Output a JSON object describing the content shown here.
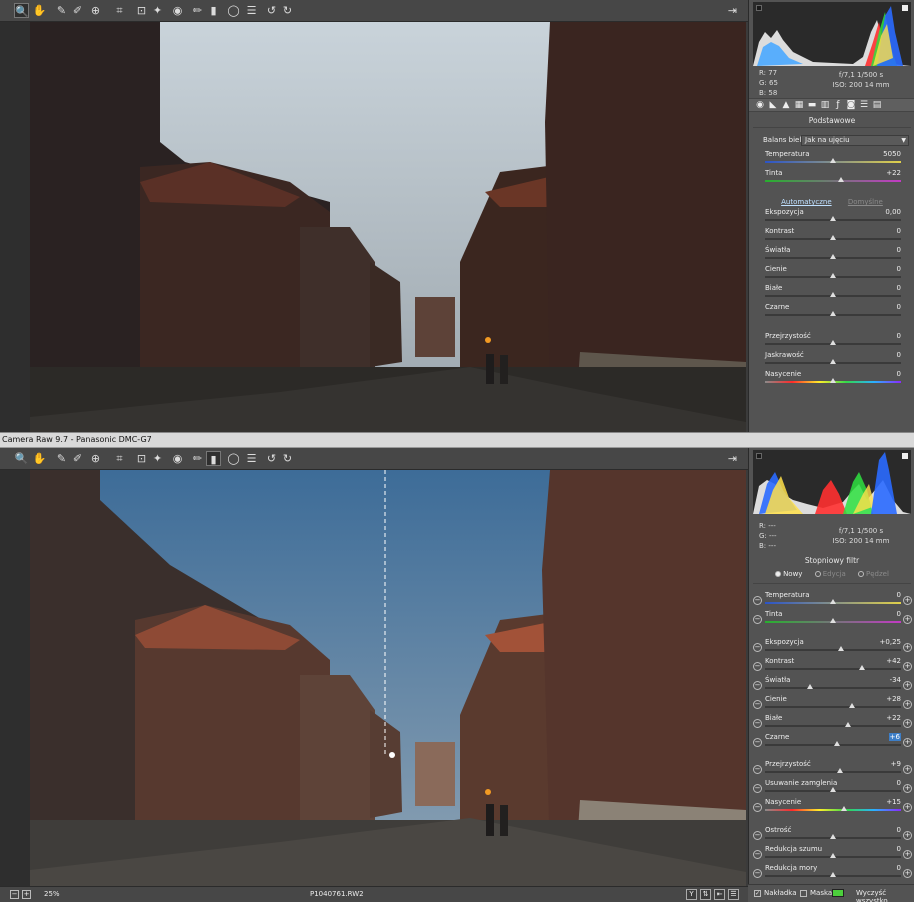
{
  "colors": {
    "accent": "#3d7ec7",
    "mask_color": "#4ccf3c"
  },
  "titlebar": {
    "title": "Camera Raw 9.7  -  Panasonic DMC-G7"
  },
  "toolbar": {
    "tools": [
      "zoom-icon",
      "hand-icon",
      "white-balance-icon",
      "color-sampler-icon",
      "targeted-adjustment-icon",
      "crop-icon",
      "straighten-icon",
      "spot-removal-icon",
      "red-eye-icon",
      "adjustment-brush-icon",
      "graduated-filter-icon",
      "radial-filter-icon",
      "preferences-icon",
      "rotate-left-icon",
      "rotate-right-icon"
    ],
    "export_icon": "open-fullscreen-icon"
  },
  "top": {
    "rgb": {
      "r": "R:   77",
      "g": "G:   65",
      "b": "B:   58"
    },
    "exif": {
      "line1": "f/7,1   1/500 s",
      "line2": "ISO: 200   14 mm"
    },
    "section": "Podstawowe",
    "wb_label": "Balans bieli:",
    "wb_value": "Jak na ujęciu",
    "sliders": [
      {
        "label": "Temperatura",
        "value": "5050",
        "pos": 0.5,
        "track": "temp"
      },
      {
        "label": "Tinta",
        "value": "+22",
        "pos": 0.56,
        "track": "tint"
      }
    ],
    "auto_link": "Automatyczne",
    "default_link": "Domyślne",
    "tone": [
      {
        "label": "Ekspozycja",
        "value": "0,00",
        "pos": 0.5
      },
      {
        "label": "Kontrast",
        "value": "0",
        "pos": 0.5
      },
      {
        "label": "Światła",
        "value": "0",
        "pos": 0.5
      },
      {
        "label": "Cienie",
        "value": "0",
        "pos": 0.5
      },
      {
        "label": "Białe",
        "value": "0",
        "pos": 0.5
      },
      {
        "label": "Czarne",
        "value": "0",
        "pos": 0.5
      }
    ],
    "presence": [
      {
        "label": "Przejrzystość",
        "value": "0",
        "pos": 0.5
      },
      {
        "label": "Jaskrawość",
        "value": "0",
        "pos": 0.5
      },
      {
        "label": "Nasycenie",
        "value": "0",
        "pos": 0.5,
        "track": "sat"
      }
    ]
  },
  "bottom": {
    "rgb": {
      "r": "R:   ---",
      "g": "G:   ---",
      "b": "B:   ---"
    },
    "exif": {
      "line1": "f/7,1   1/500 s",
      "line2": "ISO: 200   14 mm"
    },
    "section": "Stopniowy filtr",
    "radios": {
      "new": "Nowy",
      "edit": "Edycja",
      "brush": "Pędzel"
    },
    "sliders": [
      {
        "label": "Temperatura",
        "value": "0",
        "pos": 0.5,
        "track": "temp"
      },
      {
        "label": "Tinta",
        "value": "0",
        "pos": 0.5,
        "track": "tint"
      },
      {
        "label": "Ekspozycja",
        "value": "+0,25",
        "pos": 0.56
      },
      {
        "label": "Kontrast",
        "value": "+42",
        "pos": 0.71
      },
      {
        "label": "Światła",
        "value": "-34",
        "pos": 0.33
      },
      {
        "label": "Cienie",
        "value": "+28",
        "pos": 0.64
      },
      {
        "label": "Białe",
        "value": "+22",
        "pos": 0.61
      },
      {
        "label": "Czarne",
        "value": "+6",
        "pos": 0.53,
        "highlight": true
      },
      {
        "label": "Przejrzystość",
        "value": "+9",
        "pos": 0.55
      },
      {
        "label": "Usuwanie zamglenia",
        "value": "0",
        "pos": 0.5
      },
      {
        "label": "Nasycenie",
        "value": "+15",
        "pos": 0.58,
        "track": "sat"
      },
      {
        "label": "Ostrość",
        "value": "0",
        "pos": 0.5
      },
      {
        "label": "Redukcja szumu",
        "value": "0",
        "pos": 0.5
      },
      {
        "label": "Redukcja mory",
        "value": "0",
        "pos": 0.5
      }
    ],
    "footer": {
      "overlay": "Nakładka",
      "mask": "Maska",
      "clear": "Wyczyść wszystko"
    }
  },
  "statusbar": {
    "zoom": "25%",
    "filename": "P1040761.RW2"
  }
}
